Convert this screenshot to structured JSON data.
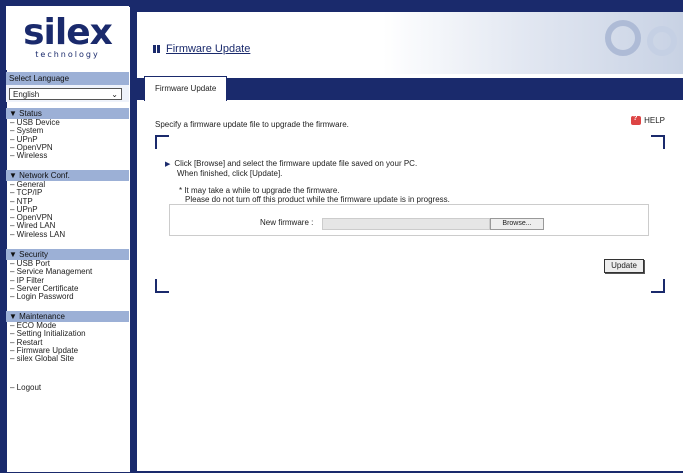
{
  "brand": {
    "logo_main": "silex",
    "logo_sub": "technology"
  },
  "language": {
    "label": "Select Language",
    "selected": "English"
  },
  "menu": {
    "status": {
      "title": "▼ Status",
      "items": [
        "– USB Device",
        "– System",
        "– UPnP",
        "– OpenVPN",
        "– Wireless"
      ]
    },
    "network": {
      "title": "▼ Network Conf.",
      "items": [
        "– General",
        "– TCP/IP",
        "– NTP",
        "– UPnP",
        "– OpenVPN",
        "– Wired LAN",
        "– Wireless LAN"
      ]
    },
    "security": {
      "title": "▼ Security",
      "items": [
        "– USB Port",
        "– Service Management",
        "– IP Filter",
        "– Server Certificate",
        "– Login Password"
      ]
    },
    "maintenance": {
      "title": "▼ Maintenance",
      "items": [
        "– ECO Mode",
        "– Setting Initialization",
        "– Restart",
        "– Firmware Update",
        "– silex Global Site"
      ]
    },
    "logout": "– Logout"
  },
  "header": {
    "title": "Firmware Update"
  },
  "tab": {
    "label": "Firmware Update"
  },
  "content": {
    "intro": "Specify a firmware update file to upgrade the firmware.",
    "help": "HELP",
    "step1_line1": "Click [Browse] and select the firmware update file saved on your PC.",
    "step1_line2": "When finished, click [Update].",
    "note_line1": "* It may take a while to upgrade the firmware.",
    "note_line2": "Please do not turn off this product while the firmware update is in progress.",
    "new_firmware_label": "New firmware :",
    "new_firmware_value": "",
    "browse_label": "Browse...",
    "update_label": "Update"
  },
  "colors": {
    "navy": "#1a2a6c",
    "menu_header": "#9cb0d6"
  }
}
